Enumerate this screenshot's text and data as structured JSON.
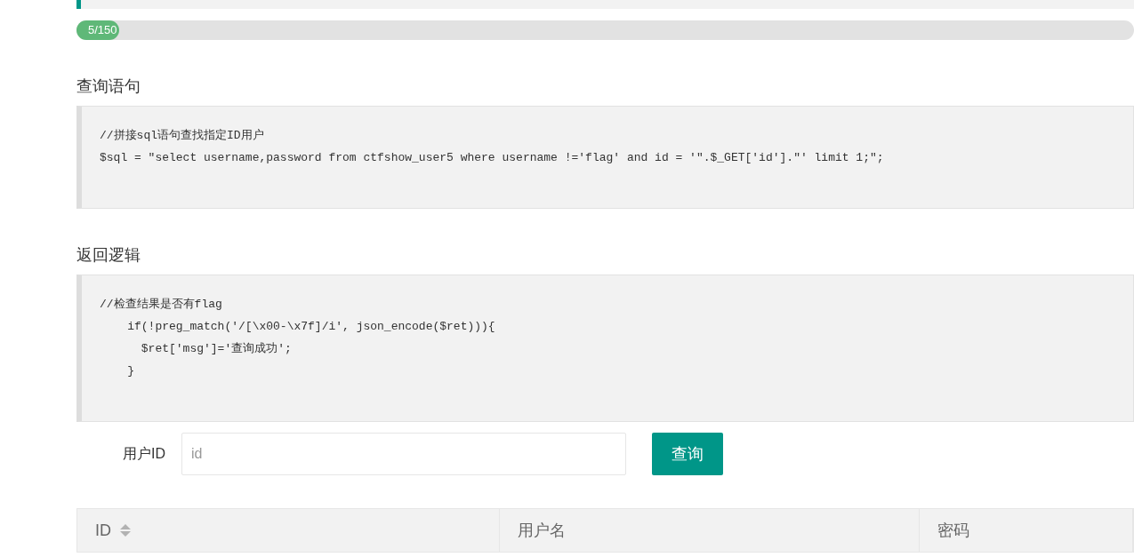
{
  "progress": {
    "label": "5/150",
    "level": 0.04
  },
  "sections": [
    {
      "title": "查询语句",
      "code": [
        "//拼接sql语句查找指定ID用户",
        "$sql = \"select username,password from ctfshow_user5 where username !='flag' and id = '\".$_GET['id'].\"' limit 1;\";"
      ]
    },
    {
      "title": "返回逻辑",
      "code": [
        "//检查结果是否有flag",
        "    if(!preg_match('/[\\x00-\\x7f]/i', json_encode($ret))){",
        "      $ret['msg']='查询成功';",
        "    }"
      ]
    }
  ],
  "form": {
    "label": "用户ID",
    "placeholder": "id",
    "button": "查询"
  },
  "table": {
    "columns": [
      {
        "label": "ID",
        "sortable": true
      },
      {
        "label": "用户名",
        "sortable": false
      },
      {
        "label": "密码",
        "sortable": false
      }
    ]
  }
}
